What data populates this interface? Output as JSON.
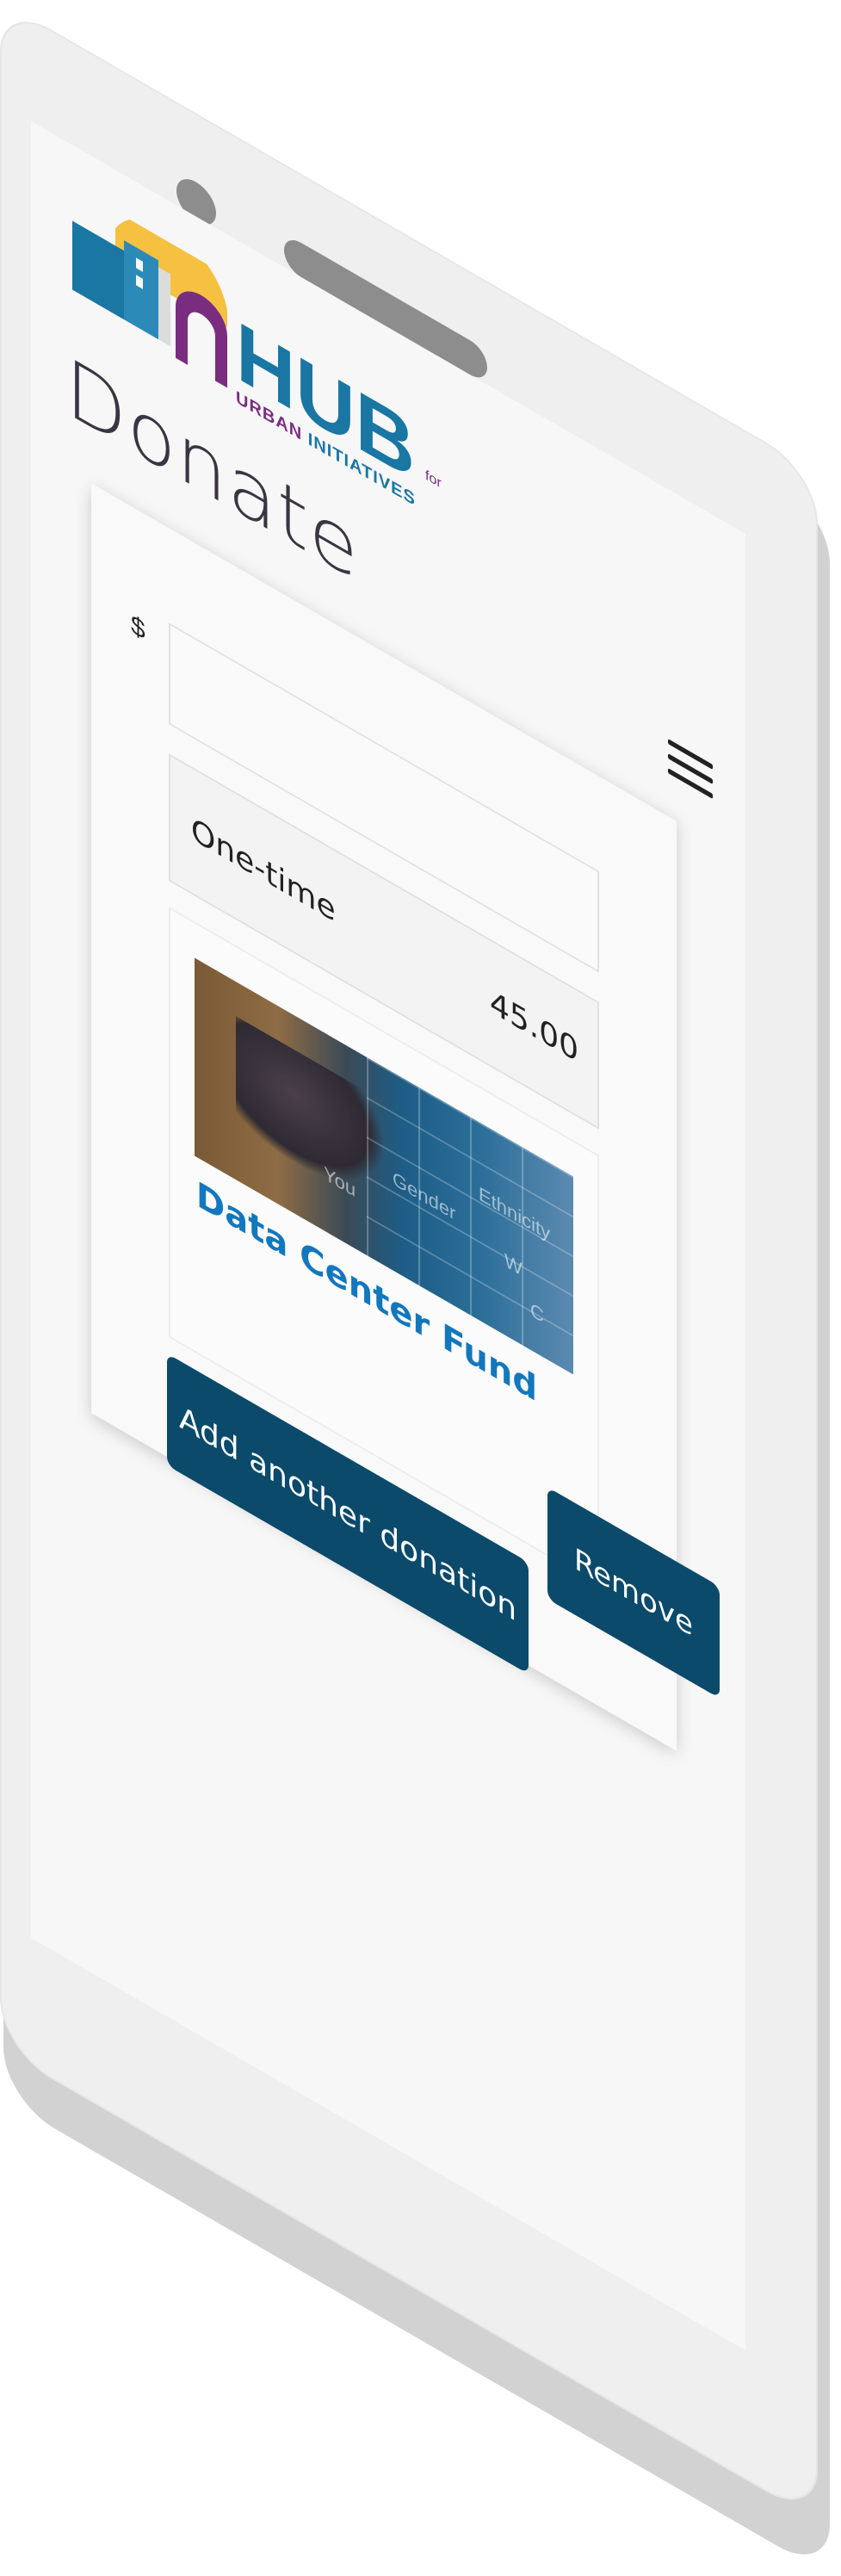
{
  "header": {
    "logo_word": "HUB",
    "logo_for": "for",
    "logo_sub_1": "URBAN",
    "logo_sub_2": "INITIATIVES"
  },
  "page": {
    "title": "Donate"
  },
  "donation": {
    "currency_symbol": "$",
    "amount_value": "",
    "frequency": "One-time",
    "frequency_amount": "45.00",
    "fund_name": "Data Center Fund",
    "image_tags": [
      "You",
      "Gender",
      "Ethnicity",
      "W",
      "C"
    ],
    "remove_label": "Remove",
    "add_label": "Add another donation"
  },
  "colors": {
    "accent": "#0b4a6a",
    "brand_blue": "#1a76a3",
    "brand_purple": "#7a2d7f",
    "fund_link": "#1377bd"
  },
  "icons": {
    "menu": "hamburger-menu-icon",
    "logo": "hub-logo-icon"
  }
}
